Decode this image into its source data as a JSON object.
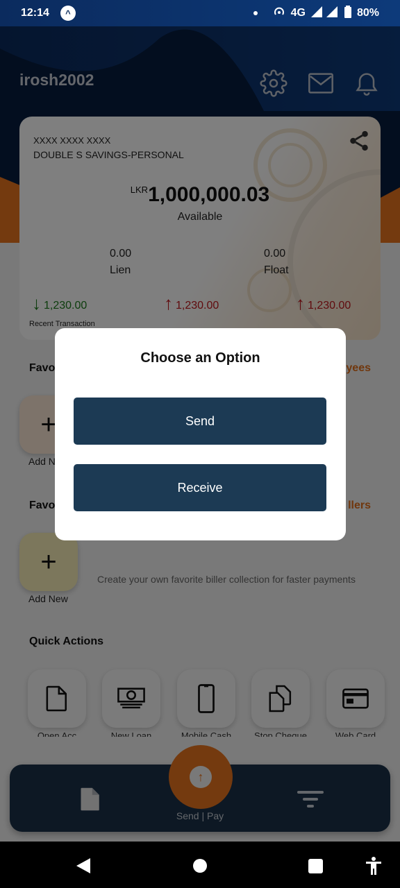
{
  "status_bar": {
    "time": "12:14",
    "network": "4G",
    "battery": "80%"
  },
  "header": {
    "username": "irosh2002"
  },
  "account_card": {
    "account_number": "XXXX XXXX XXXX",
    "account_type": "DOUBLE S SAVINGS-PERSONAL",
    "currency": "LKR",
    "balance": "1,000,000.03",
    "balance_label": "Available",
    "lien_value": "0.00",
    "lien_label": "Lien",
    "float_value": "0.00",
    "float_label": "Float",
    "transactions": [
      {
        "direction": "in",
        "amount": "1,230.00"
      },
      {
        "direction": "out",
        "amount": "1,230.00"
      },
      {
        "direction": "out",
        "amount": "1,230.00"
      }
    ],
    "recent_label": "Recent Transaction"
  },
  "favorite_payees": {
    "title": "Favo",
    "link": "yees",
    "add_label": "Add N"
  },
  "favorite_billers": {
    "title": "Favo",
    "link": "llers",
    "add_label": "Add New",
    "hint": "Create your own favorite biller collection for faster payments"
  },
  "quick_actions": {
    "title": "Quick Actions",
    "items": [
      {
        "label": "Open Acc",
        "icon": "document-icon"
      },
      {
        "label": "New Loan",
        "icon": "money-icon"
      },
      {
        "label": "Mobile Cash",
        "icon": "phone-icon"
      },
      {
        "label": "Stop Cheque",
        "icon": "copy-icon"
      },
      {
        "label": "Web Card",
        "icon": "card-icon"
      }
    ]
  },
  "bottom_nav": {
    "center_label": "Send | Pay"
  },
  "dialog": {
    "title": "Choose an Option",
    "send_label": "Send",
    "receive_label": "Receive"
  },
  "colors": {
    "primary_dark": "#1c3a54",
    "accent_orange": "#e8751f",
    "incoming_green": "#1a7a1a",
    "outgoing_red": "#c0171c"
  }
}
